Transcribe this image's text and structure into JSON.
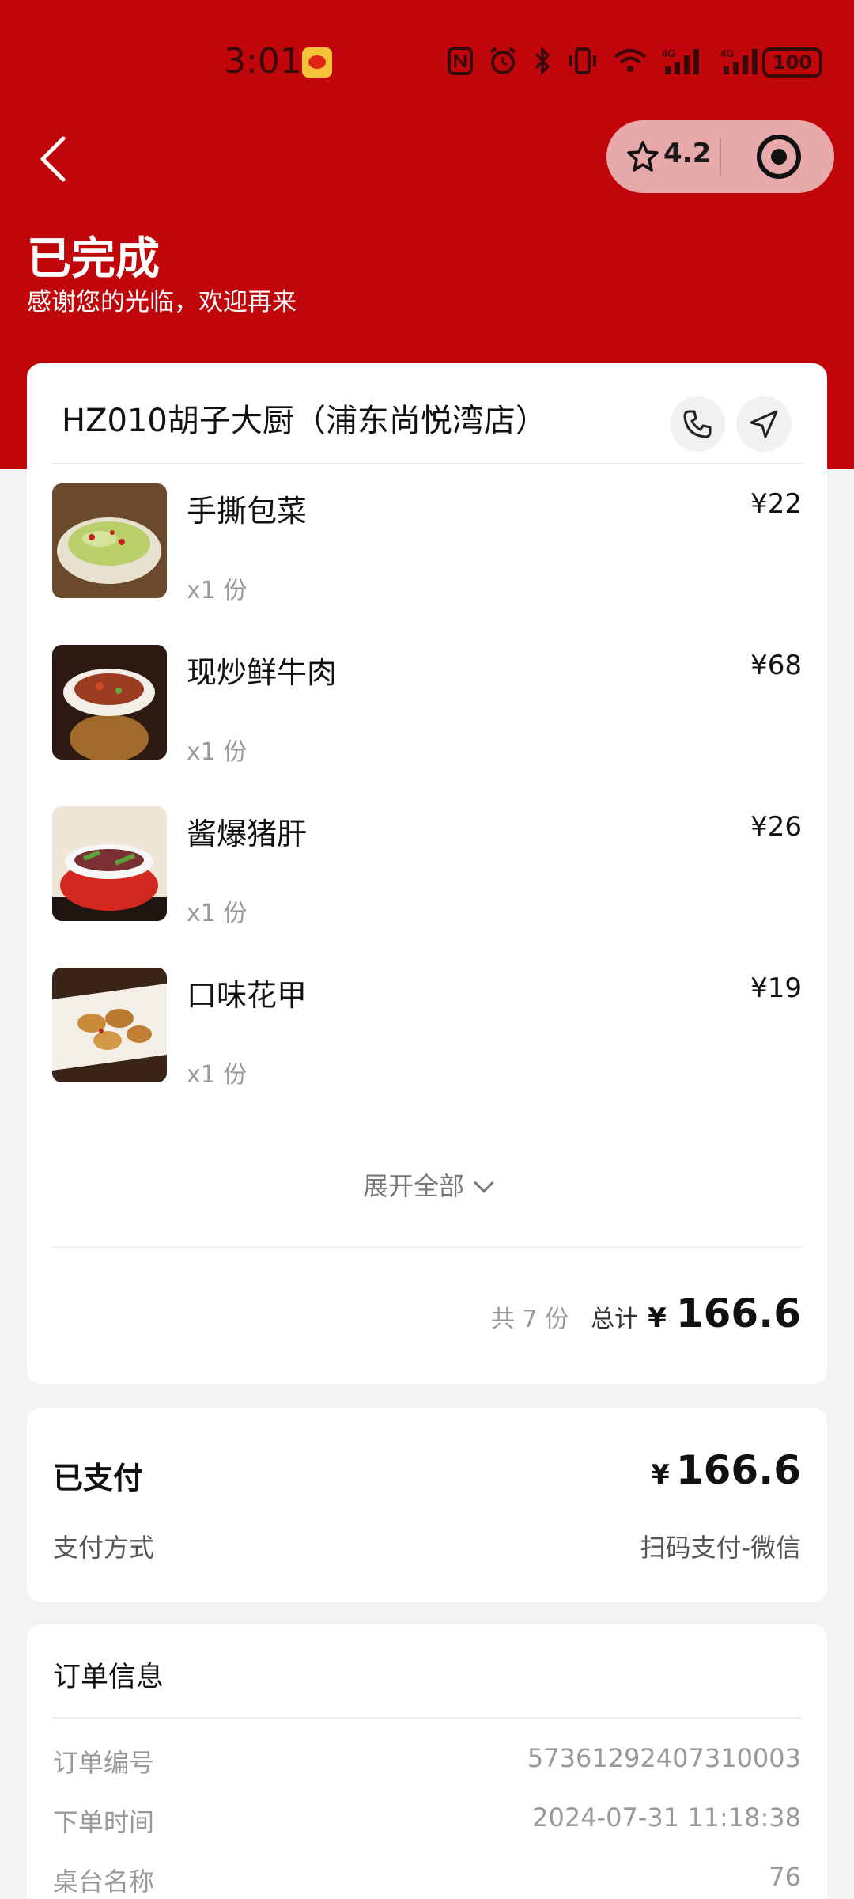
{
  "status_bar": {
    "time": "3:01",
    "battery": "100"
  },
  "capsule": {
    "rating": "4.2"
  },
  "order_status": {
    "title": "已完成",
    "subtitle": "感谢您的光临，欢迎再来"
  },
  "restaurant": {
    "name": "HZ010胡子大厨（浦东尚悦湾店）"
  },
  "items": [
    {
      "name": "手撕包菜",
      "qty": "x1 份",
      "price": "¥22"
    },
    {
      "name": "现炒鲜牛肉",
      "qty": "x1 份",
      "price": "¥68"
    },
    {
      "name": "酱爆猪肝",
      "qty": "x1 份",
      "price": "¥26"
    },
    {
      "name": "口味花甲",
      "qty": "x1 份",
      "price": "¥19"
    }
  ],
  "expand_all_label": "展开全部",
  "totals": {
    "count": "共 7 份",
    "label": "总计",
    "currency": "¥",
    "amount": "166.6"
  },
  "payment": {
    "paid_label": "已支付",
    "currency": "¥",
    "amount": "166.6",
    "method_label": "支付方式",
    "method_value": "扫码支付-微信"
  },
  "order_info": {
    "title": "订单信息",
    "rows": [
      {
        "label": "订单编号",
        "value": "57361292407310003"
      },
      {
        "label": "下单时间",
        "value": "2024-07-31 11:18:38"
      },
      {
        "label": "桌台名称",
        "value": "76"
      }
    ]
  },
  "colors": {
    "brand_red": "#c0060a"
  }
}
